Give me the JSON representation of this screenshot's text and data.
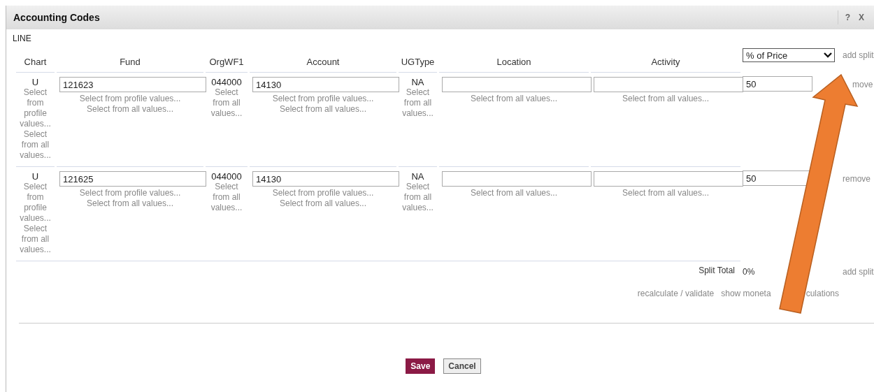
{
  "dialog": {
    "title": "Accounting Codes",
    "help": "?",
    "close": "X"
  },
  "section_label": "LINE",
  "columns": [
    "Chart",
    "Fund",
    "OrgWF1",
    "Account",
    "UGType",
    "Location",
    "Activity"
  ],
  "basis_select": {
    "value": "% of Price"
  },
  "header_link": "add split",
  "rows": [
    {
      "cells": [
        {
          "kind": "text",
          "value": "U",
          "links": [
            "Select from profile values...",
            "Select from all values..."
          ]
        },
        {
          "kind": "input",
          "value": "121623",
          "links": [
            "Select from profile values...",
            "Select from all values..."
          ]
        },
        {
          "kind": "text",
          "value": "044000",
          "links": [
            "Select from all values..."
          ]
        },
        {
          "kind": "input",
          "value": "14130",
          "links": [
            "Select from profile values...",
            "Select from all values..."
          ]
        },
        {
          "kind": "text",
          "value": "NA",
          "links": [
            "Select from all values..."
          ]
        },
        {
          "kind": "input",
          "links": [
            "Select from all values..."
          ]
        },
        {
          "kind": "input",
          "links": [
            "Select from all values..."
          ]
        }
      ],
      "percent": "50",
      "action": "move"
    },
    {
      "cells": [
        {
          "kind": "text",
          "value": "U",
          "links": [
            "Select from profile values...",
            "Select from all values..."
          ]
        },
        {
          "kind": "input",
          "value": "121625",
          "links": [
            "Select from profile values...",
            "Select from all values..."
          ]
        },
        {
          "kind": "text",
          "value": "044000",
          "links": [
            "Select from all values..."
          ]
        },
        {
          "kind": "input",
          "value": "14130",
          "links": [
            "Select from profile values...",
            "Select from all values..."
          ]
        },
        {
          "kind": "text",
          "value": "NA",
          "links": [
            "Select from all values..."
          ]
        },
        {
          "kind": "input",
          "links": [
            "Select from all values..."
          ]
        },
        {
          "kind": "input",
          "links": [
            "Select from all values..."
          ]
        }
      ],
      "percent": "50",
      "action": "remove"
    }
  ],
  "split_total": {
    "label": "Split Total",
    "value": "0%",
    "link": "add split"
  },
  "footer_links": [
    "recalculate / validate",
    "show moneta",
    "culations"
  ],
  "buttons": [
    {
      "label": "Save",
      "kind": "primary"
    },
    {
      "label": "Cancel",
      "kind": "secondary"
    }
  ]
}
